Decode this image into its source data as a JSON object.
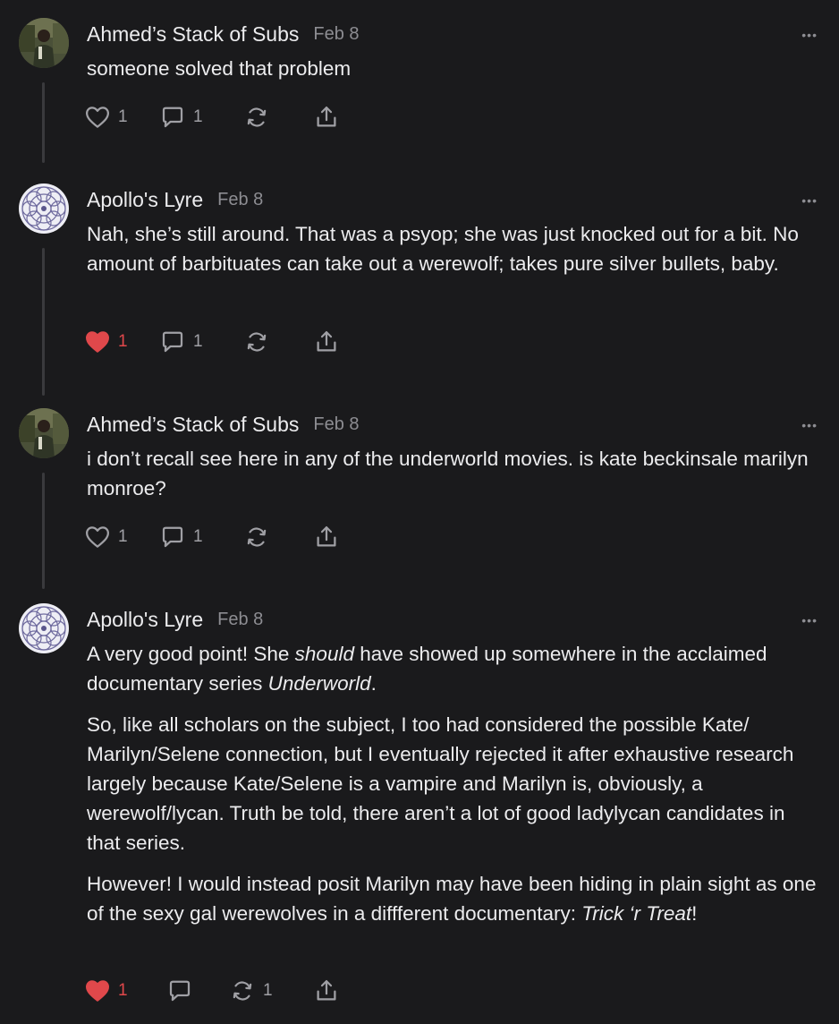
{
  "comments": [
    {
      "author": "Ahmed’s Stack of Subs",
      "date": "Feb 8",
      "avatar_icon": "person-photo-avatar",
      "paragraphs": [
        "someone solved that problem"
      ],
      "liked": false,
      "like_count": "1",
      "reply_count": "1",
      "restack_count": ""
    },
    {
      "author": "Apollo's Lyre",
      "date": "Feb 8",
      "avatar_icon": "mandala-avatar",
      "paragraphs": [
        "Nah, she’s still around. That was a psyop; she was just knocked out for a bit. No amount of barbituates can take out a werewolf; takes pure silver bullets, baby."
      ],
      "liked": true,
      "like_count": "1",
      "reply_count": "1",
      "restack_count": ""
    },
    {
      "author": "Ahmed’s Stack of Subs",
      "date": "Feb 8",
      "avatar_icon": "person-photo-avatar",
      "paragraphs": [
        "i don’t recall see here in any of the underworld movies. is kate beckinsale marilyn monroe?"
      ],
      "liked": false,
      "like_count": "1",
      "reply_count": "1",
      "restack_count": ""
    },
    {
      "author": "Apollo's Lyre",
      "date": "Feb 8",
      "avatar_icon": "mandala-avatar",
      "paragraphs_rich": [
        [
          {
            "t": "A very good point! She "
          },
          {
            "t": "should",
            "i": true
          },
          {
            "t": " have showed up somewhere in the acclaimed documentary series "
          },
          {
            "t": "Underworld",
            "i": true
          },
          {
            "t": "."
          }
        ],
        [
          {
            "t": "So, like all scholars on the subject, I too had considered the possible Kate/ Marilyn/Selene connection, but I eventually rejected it after exhaustive research largely because Kate/Selene is a vampire and Marilyn is, obviously, a werewolf/lycan. Truth be told, there aren’t a lot of good ladylycan candidates in that series."
          }
        ],
        [
          {
            "t": "However! I would instead posit Marilyn may have been hiding in plain sight as one of the sexy gal werewolves in a diffferent documentary: "
          },
          {
            "t": "Trick ‘r Treat",
            "i": true
          },
          {
            "t": "!"
          }
        ]
      ],
      "liked": true,
      "like_count": "1",
      "reply_count": "",
      "restack_count": "1"
    }
  ],
  "more_label": "•••",
  "colors": {
    "background": "#1a1a1c",
    "text": "#ececee",
    "muted": "#8d8d92",
    "heart_liked": "#e0484b"
  },
  "icons": {
    "like": "heart-icon",
    "reply": "speech-bubble-icon",
    "restack": "restack-arrows-icon",
    "share": "share-upload-icon",
    "more": "ellipsis-icon"
  }
}
